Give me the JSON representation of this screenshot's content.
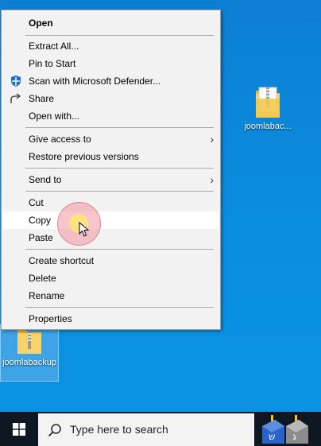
{
  "desktop": {
    "icons": [
      {
        "label": "joomlabac..."
      },
      {
        "label": "joomlabackup"
      }
    ]
  },
  "context_menu": {
    "items": [
      {
        "label": "Open"
      },
      {
        "label": "Extract All..."
      },
      {
        "label": "Pin to Start"
      },
      {
        "label": "Scan with Microsoft Defender..."
      },
      {
        "label": "Share"
      },
      {
        "label": "Open with..."
      },
      {
        "label": "Give access to"
      },
      {
        "label": "Restore previous versions"
      },
      {
        "label": "Send to"
      },
      {
        "label": "Cut"
      },
      {
        "label": "Copy"
      },
      {
        "label": "Paste"
      },
      {
        "label": "Create shortcut"
      },
      {
        "label": "Delete"
      },
      {
        "label": "Rename"
      },
      {
        "label": "Properties"
      }
    ],
    "highlighted_item": "Copy"
  },
  "taskbar": {
    "search_placeholder": "Type here to search"
  },
  "colors": {
    "desktop": "#0a84d6",
    "taskbar": "#0f1723",
    "menu_bg": "#f2f2f2",
    "highlight": "#ffffff"
  }
}
